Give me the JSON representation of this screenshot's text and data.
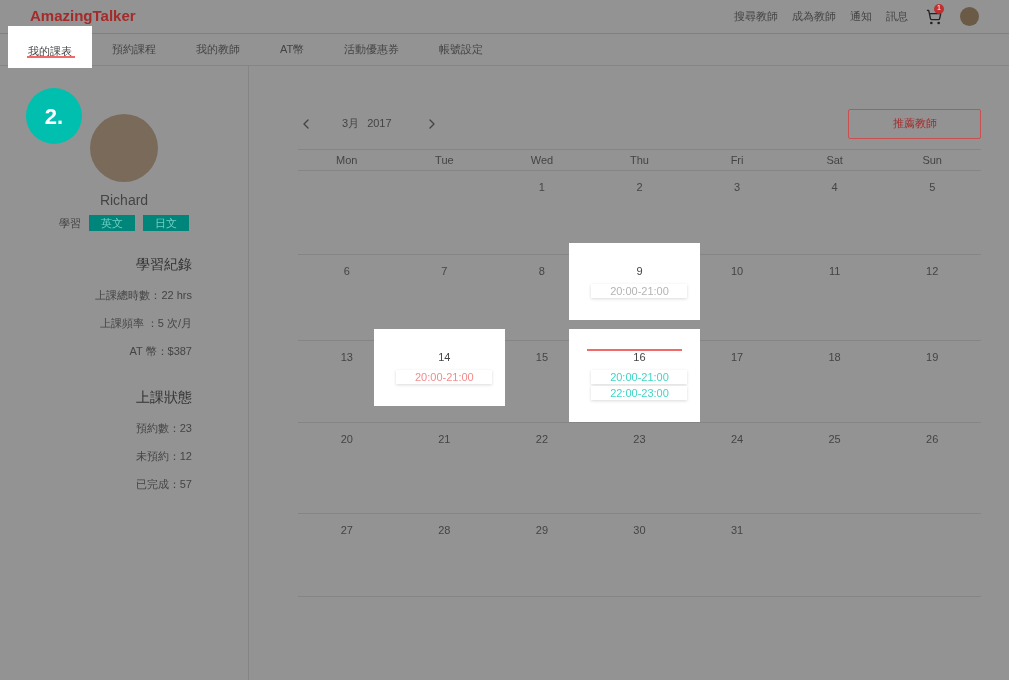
{
  "header": {
    "logo": "AmazingTalker",
    "links": [
      "搜尋教師",
      "成為教師",
      "通知",
      "訊息"
    ],
    "cart_badge": "1"
  },
  "tabs": [
    {
      "label": "我的課表",
      "selected": true,
      "highlighted": true
    },
    {
      "label": "預約課程",
      "selected": false,
      "highlighted": false
    },
    {
      "label": "我的教師",
      "selected": false,
      "highlighted": false
    },
    {
      "label": "AT幣",
      "selected": false,
      "highlighted": false
    },
    {
      "label": "活動優惠券",
      "selected": false,
      "highlighted": false
    },
    {
      "label": "帳號設定",
      "selected": false,
      "highlighted": false
    }
  ],
  "step_badge": "2.",
  "profile": {
    "name": "Richard",
    "learning_label": "學習",
    "languages": [
      "英文",
      "日文"
    ]
  },
  "record": {
    "title": "學習紀錄",
    "lines": [
      "上課總時數：22 hrs",
      "上課頻率 ：5 次/月",
      "AT 幣：$387"
    ]
  },
  "status": {
    "title": "上課狀態",
    "lines": [
      "預約數：23",
      "未預約：12",
      "已完成：57"
    ]
  },
  "calendar": {
    "month": "3月",
    "year": "2017",
    "recommend_button": "推薦教師",
    "weekdays": [
      "Mon",
      "Tue",
      "Wed",
      "Thu",
      "Fri",
      "Sat",
      "Sun"
    ],
    "weeks": [
      [
        {
          "day": "1"
        },
        {
          "day": "2"
        },
        {
          "day": "3"
        },
        {
          "day": "4"
        },
        {
          "day": "5"
        }
      ],
      [
        {
          "day": "6"
        },
        {
          "day": "7"
        },
        {
          "day": "8"
        },
        {
          "day": "9",
          "highlighted": true,
          "events": [
            {
              "time": "20:00-21:00",
              "color": "#b4b4b4"
            }
          ]
        },
        {
          "day": "10"
        },
        {
          "day": "11"
        },
        {
          "day": "12"
        }
      ],
      [
        {
          "day": "13"
        },
        {
          "day": "14",
          "highlighted": true,
          "events": [
            {
              "time": "20:00-21:00",
              "color": "#f28b8b"
            }
          ]
        },
        {
          "day": "15"
        },
        {
          "day": "16",
          "highlighted": true,
          "today": true,
          "events": [
            {
              "time": "20:00-21:00",
              "color": "#3fd6c6"
            },
            {
              "time": "22:00-23:00",
              "color": "#3fd6c6"
            }
          ]
        },
        {
          "day": "17"
        },
        {
          "day": "18"
        },
        {
          "day": "19"
        }
      ],
      [
        {
          "day": "20"
        },
        {
          "day": "21"
        },
        {
          "day": "22"
        },
        {
          "day": "23"
        },
        {
          "day": "24"
        },
        {
          "day": "25"
        },
        {
          "day": "26"
        }
      ],
      [
        {
          "day": "27"
        },
        {
          "day": "28"
        },
        {
          "day": "29"
        },
        {
          "day": "30"
        },
        {
          "day": "31"
        }
      ]
    ]
  }
}
